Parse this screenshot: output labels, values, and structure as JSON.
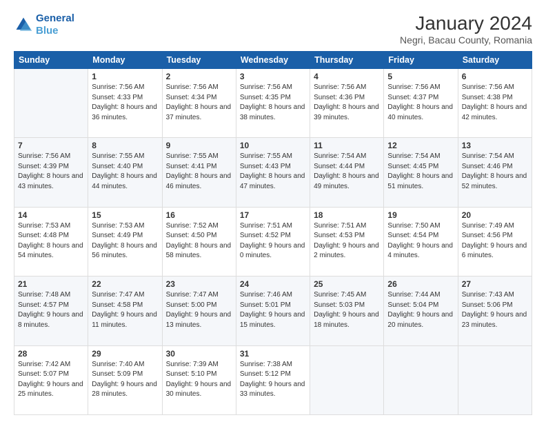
{
  "logo": {
    "line1": "General",
    "line2": "Blue"
  },
  "title": "January 2024",
  "subtitle": "Negri, Bacau County, Romania",
  "header_days": [
    "Sunday",
    "Monday",
    "Tuesday",
    "Wednesday",
    "Thursday",
    "Friday",
    "Saturday"
  ],
  "weeks": [
    [
      {
        "day": "",
        "sunrise": "",
        "sunset": "",
        "daylight": ""
      },
      {
        "day": "1",
        "sunrise": "Sunrise: 7:56 AM",
        "sunset": "Sunset: 4:33 PM",
        "daylight": "Daylight: 8 hours and 36 minutes."
      },
      {
        "day": "2",
        "sunrise": "Sunrise: 7:56 AM",
        "sunset": "Sunset: 4:34 PM",
        "daylight": "Daylight: 8 hours and 37 minutes."
      },
      {
        "day": "3",
        "sunrise": "Sunrise: 7:56 AM",
        "sunset": "Sunset: 4:35 PM",
        "daylight": "Daylight: 8 hours and 38 minutes."
      },
      {
        "day": "4",
        "sunrise": "Sunrise: 7:56 AM",
        "sunset": "Sunset: 4:36 PM",
        "daylight": "Daylight: 8 hours and 39 minutes."
      },
      {
        "day": "5",
        "sunrise": "Sunrise: 7:56 AM",
        "sunset": "Sunset: 4:37 PM",
        "daylight": "Daylight: 8 hours and 40 minutes."
      },
      {
        "day": "6",
        "sunrise": "Sunrise: 7:56 AM",
        "sunset": "Sunset: 4:38 PM",
        "daylight": "Daylight: 8 hours and 42 minutes."
      }
    ],
    [
      {
        "day": "7",
        "sunrise": "Sunrise: 7:56 AM",
        "sunset": "Sunset: 4:39 PM",
        "daylight": "Daylight: 8 hours and 43 minutes."
      },
      {
        "day": "8",
        "sunrise": "Sunrise: 7:55 AM",
        "sunset": "Sunset: 4:40 PM",
        "daylight": "Daylight: 8 hours and 44 minutes."
      },
      {
        "day": "9",
        "sunrise": "Sunrise: 7:55 AM",
        "sunset": "Sunset: 4:41 PM",
        "daylight": "Daylight: 8 hours and 46 minutes."
      },
      {
        "day": "10",
        "sunrise": "Sunrise: 7:55 AM",
        "sunset": "Sunset: 4:43 PM",
        "daylight": "Daylight: 8 hours and 47 minutes."
      },
      {
        "day": "11",
        "sunrise": "Sunrise: 7:54 AM",
        "sunset": "Sunset: 4:44 PM",
        "daylight": "Daylight: 8 hours and 49 minutes."
      },
      {
        "day": "12",
        "sunrise": "Sunrise: 7:54 AM",
        "sunset": "Sunset: 4:45 PM",
        "daylight": "Daylight: 8 hours and 51 minutes."
      },
      {
        "day": "13",
        "sunrise": "Sunrise: 7:54 AM",
        "sunset": "Sunset: 4:46 PM",
        "daylight": "Daylight: 8 hours and 52 minutes."
      }
    ],
    [
      {
        "day": "14",
        "sunrise": "Sunrise: 7:53 AM",
        "sunset": "Sunset: 4:48 PM",
        "daylight": "Daylight: 8 hours and 54 minutes."
      },
      {
        "day": "15",
        "sunrise": "Sunrise: 7:53 AM",
        "sunset": "Sunset: 4:49 PM",
        "daylight": "Daylight: 8 hours and 56 minutes."
      },
      {
        "day": "16",
        "sunrise": "Sunrise: 7:52 AM",
        "sunset": "Sunset: 4:50 PM",
        "daylight": "Daylight: 8 hours and 58 minutes."
      },
      {
        "day": "17",
        "sunrise": "Sunrise: 7:51 AM",
        "sunset": "Sunset: 4:52 PM",
        "daylight": "Daylight: 9 hours and 0 minutes."
      },
      {
        "day": "18",
        "sunrise": "Sunrise: 7:51 AM",
        "sunset": "Sunset: 4:53 PM",
        "daylight": "Daylight: 9 hours and 2 minutes."
      },
      {
        "day": "19",
        "sunrise": "Sunrise: 7:50 AM",
        "sunset": "Sunset: 4:54 PM",
        "daylight": "Daylight: 9 hours and 4 minutes."
      },
      {
        "day": "20",
        "sunrise": "Sunrise: 7:49 AM",
        "sunset": "Sunset: 4:56 PM",
        "daylight": "Daylight: 9 hours and 6 minutes."
      }
    ],
    [
      {
        "day": "21",
        "sunrise": "Sunrise: 7:48 AM",
        "sunset": "Sunset: 4:57 PM",
        "daylight": "Daylight: 9 hours and 8 minutes."
      },
      {
        "day": "22",
        "sunrise": "Sunrise: 7:47 AM",
        "sunset": "Sunset: 4:58 PM",
        "daylight": "Daylight: 9 hours and 11 minutes."
      },
      {
        "day": "23",
        "sunrise": "Sunrise: 7:47 AM",
        "sunset": "Sunset: 5:00 PM",
        "daylight": "Daylight: 9 hours and 13 minutes."
      },
      {
        "day": "24",
        "sunrise": "Sunrise: 7:46 AM",
        "sunset": "Sunset: 5:01 PM",
        "daylight": "Daylight: 9 hours and 15 minutes."
      },
      {
        "day": "25",
        "sunrise": "Sunrise: 7:45 AM",
        "sunset": "Sunset: 5:03 PM",
        "daylight": "Daylight: 9 hours and 18 minutes."
      },
      {
        "day": "26",
        "sunrise": "Sunrise: 7:44 AM",
        "sunset": "Sunset: 5:04 PM",
        "daylight": "Daylight: 9 hours and 20 minutes."
      },
      {
        "day": "27",
        "sunrise": "Sunrise: 7:43 AM",
        "sunset": "Sunset: 5:06 PM",
        "daylight": "Daylight: 9 hours and 23 minutes."
      }
    ],
    [
      {
        "day": "28",
        "sunrise": "Sunrise: 7:42 AM",
        "sunset": "Sunset: 5:07 PM",
        "daylight": "Daylight: 9 hours and 25 minutes."
      },
      {
        "day": "29",
        "sunrise": "Sunrise: 7:40 AM",
        "sunset": "Sunset: 5:09 PM",
        "daylight": "Daylight: 9 hours and 28 minutes."
      },
      {
        "day": "30",
        "sunrise": "Sunrise: 7:39 AM",
        "sunset": "Sunset: 5:10 PM",
        "daylight": "Daylight: 9 hours and 30 minutes."
      },
      {
        "day": "31",
        "sunrise": "Sunrise: 7:38 AM",
        "sunset": "Sunset: 5:12 PM",
        "daylight": "Daylight: 9 hours and 33 minutes."
      },
      {
        "day": "",
        "sunrise": "",
        "sunset": "",
        "daylight": ""
      },
      {
        "day": "",
        "sunrise": "",
        "sunset": "",
        "daylight": ""
      },
      {
        "day": "",
        "sunrise": "",
        "sunset": "",
        "daylight": ""
      }
    ]
  ]
}
